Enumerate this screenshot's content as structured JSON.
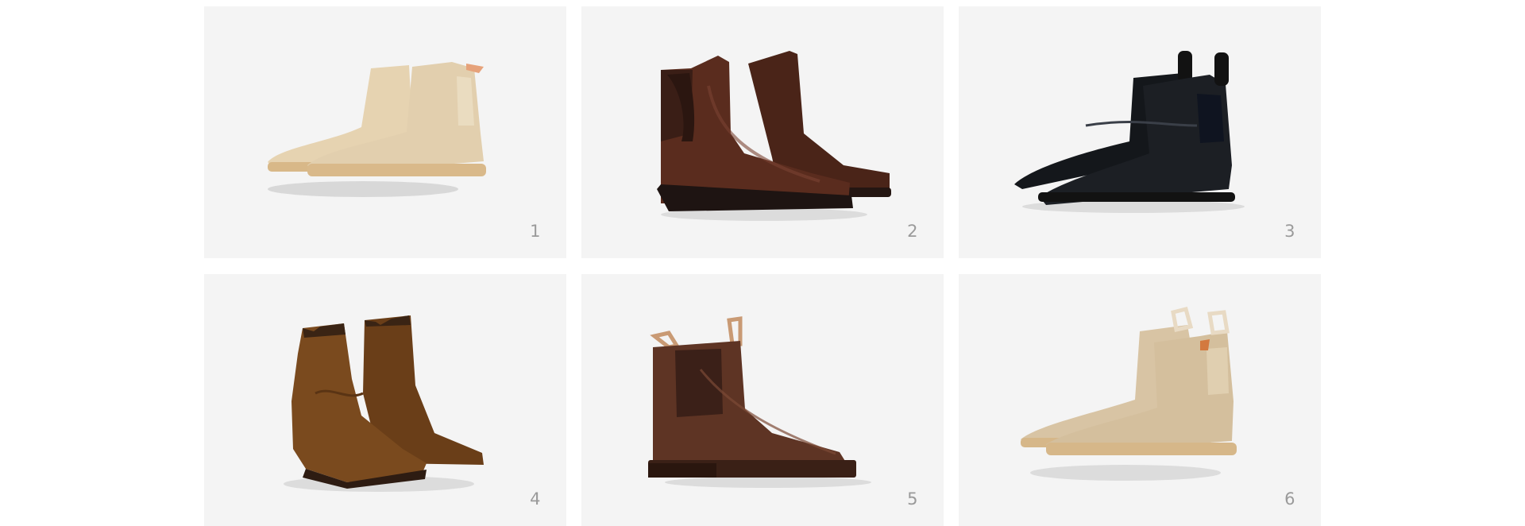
{
  "products": [
    {
      "number": "1",
      "icon": "tan-suede-chelsea-boot-icon",
      "color": "#e2cfae",
      "sole": "#d9b98a"
    },
    {
      "number": "2",
      "icon": "brown-leather-chelsea-boot-icon",
      "color": "#5a2c1e",
      "sole": "#2a1a14"
    },
    {
      "number": "3",
      "icon": "black-leather-chelsea-boot-icon",
      "color": "#1c1f24",
      "sole": "#141414"
    },
    {
      "number": "4",
      "icon": "brown-suede-western-boot-icon",
      "color": "#7a4a1e",
      "sole": "#3a2414"
    },
    {
      "number": "5",
      "icon": "brown-leather-pull-tab-boot-icon",
      "color": "#5e3424",
      "sole": "#3a2016"
    },
    {
      "number": "6",
      "icon": "sand-suede-chelsea-boot-icon",
      "color": "#d8c4a4",
      "sole": "#d6b789"
    }
  ]
}
